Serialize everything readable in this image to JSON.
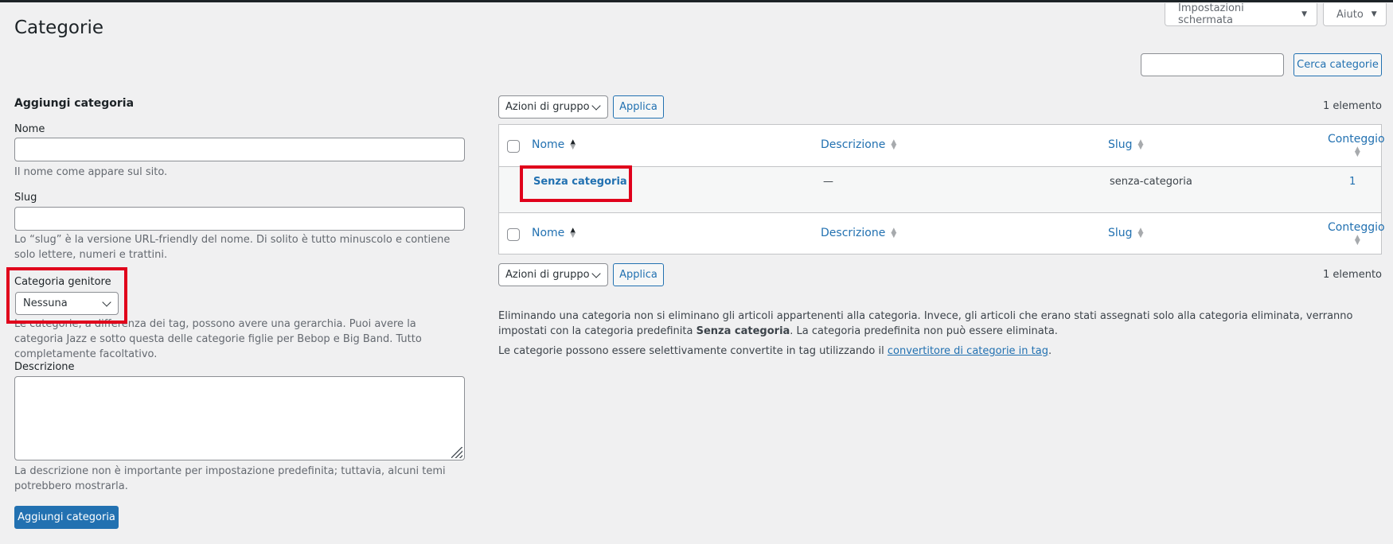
{
  "header": {
    "screen_options_label": "Impostazioni schermata",
    "help_label": "Aiuto",
    "page_title": "Categorie",
    "search_button_label": "Cerca categorie",
    "search_value": ""
  },
  "add_form": {
    "title": "Aggiungi categoria",
    "name_label": "Nome",
    "name_value": "",
    "name_help": "Il nome come appare sul sito.",
    "slug_label": "Slug",
    "slug_value": "",
    "slug_help": "Lo “slug” è la versione URL-friendly del nome. Di solito è tutto minuscolo e contiene solo lettere, numeri e trattini.",
    "parent_label": "Categoria genitore",
    "parent_selected": "Nessuna",
    "parent_help": "Le categorie, a differenza dei tag, possono avere una gerarchia. Puoi avere la categoria Jazz e sotto questa delle categorie figlie per Bebop e Big Band. Tutto completamente facoltativo.",
    "description_label": "Descrizione",
    "description_value": "",
    "description_help": "La descrizione non è importante per impostazione predefinita; tuttavia, alcuni temi potrebbero mostrarla.",
    "submit_label": "Aggiungi categoria"
  },
  "list": {
    "bulk_actions_label": "Azioni di gruppo",
    "apply_label": "Applica",
    "item_count": "1 elemento",
    "columns": {
      "name": "Nome",
      "description": "Descrizione",
      "slug": "Slug",
      "count": "Conteggio"
    },
    "rows": [
      {
        "name": "Senza categoria",
        "description": "—",
        "slug": "senza-categoria",
        "count": "1"
      }
    ]
  },
  "notes": {
    "delete_note_prefix": "Eliminando una categoria non si eliminano gli articoli appartenenti alla categoria. Invece, gli articoli che erano stati assegnati solo alla categoria eliminata, verranno impostati con la categoria predefinita ",
    "delete_note_default": "Senza categoria",
    "delete_note_suffix": ". La categoria predefinita non può essere eliminata.",
    "convert_note_prefix": "Le categorie possono essere selettivamente convertite in tag utilizzando il ",
    "convert_link": "convertitore di categorie in tag",
    "convert_note_suffix": "."
  },
  "colors": {
    "accent": "#2271b1",
    "highlight": "#e0001b",
    "background": "#f0f0f1"
  }
}
